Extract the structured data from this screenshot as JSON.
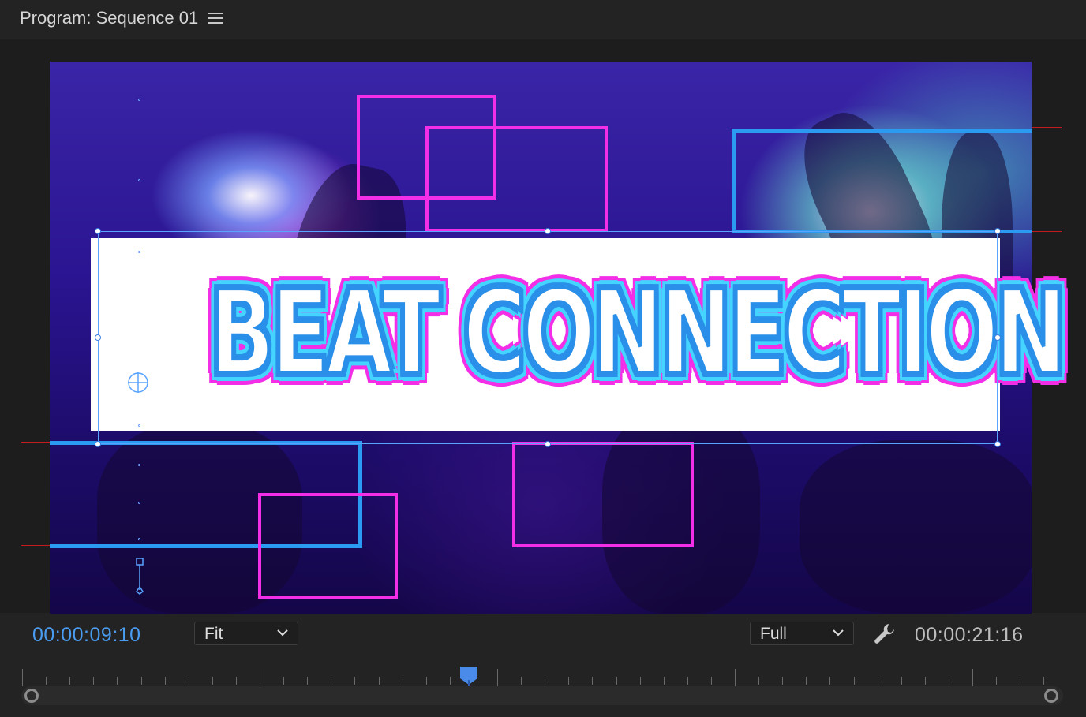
{
  "panel": {
    "title": "Program: Sequence 01",
    "menu_icon": "hamburger-menu-icon"
  },
  "video": {
    "title_text": "BEAT CONNECTION",
    "colors": {
      "pink": "#f22fe6",
      "blue": "#2a9bf0",
      "cyan": "#44d4ff",
      "selection": "#5aa3ff",
      "guide": "#c41c1c"
    }
  },
  "controls": {
    "current_timecode": "00:00:09:10",
    "zoom_select": "Fit",
    "resolution_select": "Full",
    "settings_icon": "wrench-icon",
    "duration_timecode": "00:00:21:16"
  }
}
